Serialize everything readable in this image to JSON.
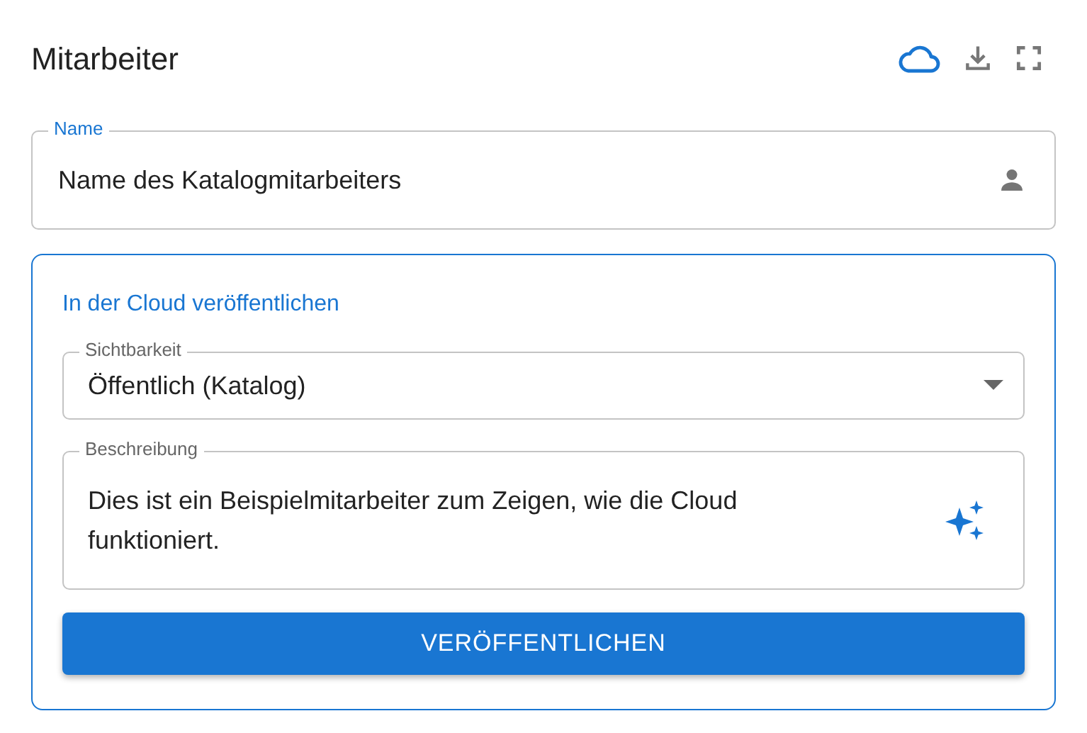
{
  "header": {
    "title": "Mitarbeiter"
  },
  "name_field": {
    "label": "Name",
    "value": "Name des Katalogmitarbeiters"
  },
  "publish_card": {
    "title": "In der Cloud veröffentlichen",
    "visibility": {
      "label": "Sichtbarkeit",
      "value": "Öffentlich (Katalog)"
    },
    "description": {
      "label": "Beschreibung",
      "value": "Dies ist ein Beispielmitarbeiter zum Zeigen, wie die Cloud funktioniert."
    },
    "button": "VERÖFFENTLICHEN"
  }
}
